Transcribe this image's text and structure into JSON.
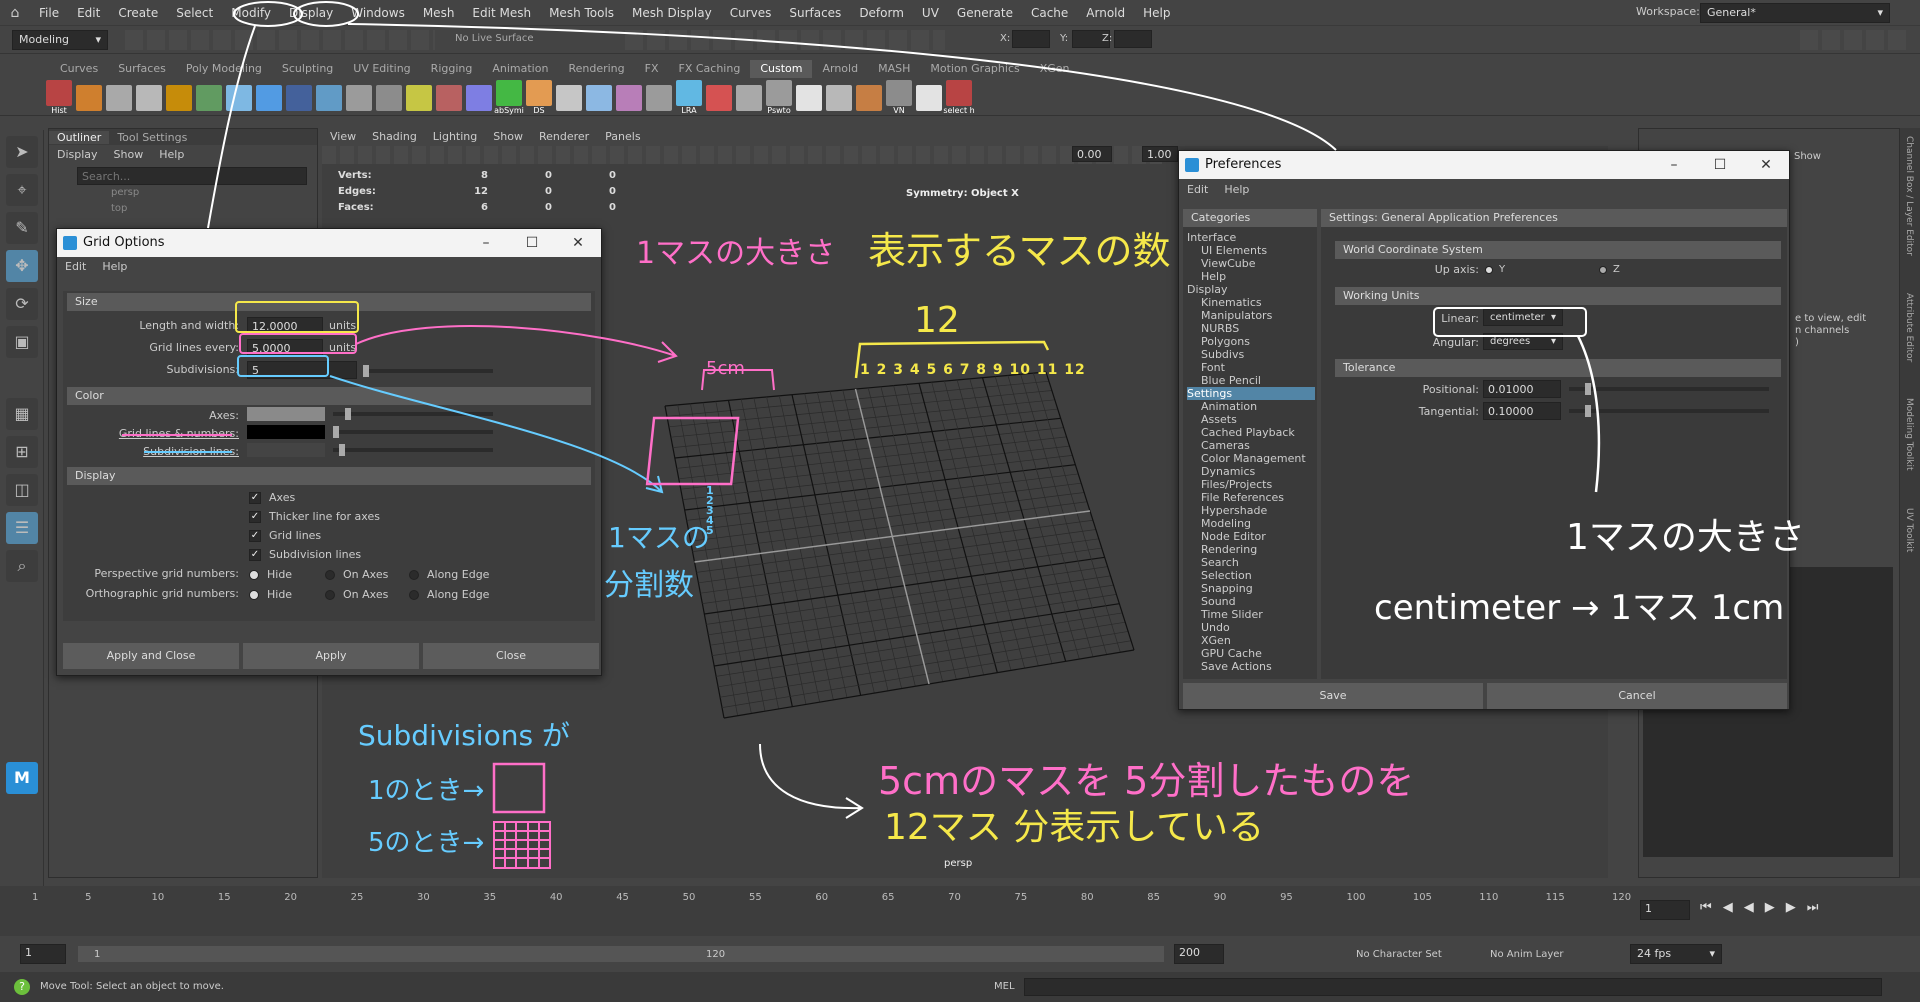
{
  "menubar": {
    "items": [
      "File",
      "Edit",
      "Create",
      "Select",
      "Modify",
      "Display",
      "Windows",
      "Mesh",
      "Edit Mesh",
      "Mesh Tools",
      "Mesh Display",
      "Curves",
      "Surfaces",
      "Deform",
      "UV",
      "Generate",
      "Cache",
      "Arnold",
      "Help"
    ],
    "workspace_label": "Workspace:",
    "workspace_value": "General*"
  },
  "toolbar": {
    "mode": "Modeling",
    "live_surface": "No Live Surface",
    "x": "X:",
    "y": "Y:",
    "z": "Z:"
  },
  "shelf": {
    "tabs": [
      "Curves",
      "Surfaces",
      "Poly Modeling",
      "Sculpting",
      "UV Editing",
      "Rigging",
      "Animation",
      "Rendering",
      "FX",
      "FX Caching",
      "Custom",
      "Arnold",
      "MASH",
      "Motion Graphics",
      "XGen"
    ],
    "active": "Custom",
    "icon_labels": [
      "Hist",
      "abSymi",
      "DS",
      "LRA",
      "Pswto",
      "VN",
      "select h"
    ]
  },
  "outliner": {
    "tabs": [
      "Outliner",
      "Tool Settings"
    ],
    "menu": [
      "Display",
      "Show",
      "Help"
    ],
    "search_placeholder": "Search...",
    "items": [
      "persp",
      "top"
    ]
  },
  "viewport": {
    "menu": [
      "View",
      "Shading",
      "Lighting",
      "Show",
      "Renderer",
      "Panels"
    ],
    "hud": {
      "rows": [
        {
          "k": "Verts:",
          "v": [
            "8",
            "0",
            "0"
          ]
        },
        {
          "k": "Edges:",
          "v": [
            "12",
            "0",
            "0"
          ]
        },
        {
          "k": "Faces:",
          "v": [
            "6",
            "0",
            "0"
          ]
        }
      ]
    },
    "symmetry": "Symmetry: Object X",
    "camera": "persp",
    "field_a": "0.00",
    "field_b": "1.00"
  },
  "grid_options": {
    "title": "Grid Options",
    "menu": [
      "Edit",
      "Help"
    ],
    "size_section": "Size",
    "length_label": "Length and width:",
    "length_value": "12.0000",
    "units": "units",
    "gridlines_label": "Grid lines every:",
    "gridlines_value": "5.0000",
    "subdiv_label": "Subdivisions:",
    "subdiv_value": "5",
    "color_section": "Color",
    "axes_label": "Axes:",
    "gridcolor_label": "Grid lines & numbers:",
    "subcolor_label": "Subdivision lines:",
    "display_section": "Display",
    "chk_axes": "Axes",
    "chk_thicker": "Thicker line for axes",
    "chk_grid": "Grid lines",
    "chk_subdiv": "Subdivision lines",
    "persp_label": "Perspective grid numbers:",
    "ortho_label": "Orthographic grid numbers:",
    "opt_hide": "Hide",
    "opt_on_axes": "On Axes",
    "opt_along_edge": "Along Edge",
    "btn_apply_close": "Apply and Close",
    "btn_apply": "Apply",
    "btn_close": "Close"
  },
  "preferences": {
    "title": "Preferences",
    "menu": [
      "Edit",
      "Help"
    ],
    "categories_header": "Categories",
    "settings_header": "Settings: General Application Preferences",
    "categories": [
      {
        "t": "Interface",
        "s": 0
      },
      {
        "t": "UI Elements",
        "s": 1
      },
      {
        "t": "ViewCube",
        "s": 1
      },
      {
        "t": "Help",
        "s": 1
      },
      {
        "t": "Display",
        "s": 0
      },
      {
        "t": "Kinematics",
        "s": 1
      },
      {
        "t": "Manipulators",
        "s": 1
      },
      {
        "t": "NURBS",
        "s": 1
      },
      {
        "t": "Polygons",
        "s": 1
      },
      {
        "t": "Subdivs",
        "s": 1
      },
      {
        "t": "Font",
        "s": 1
      },
      {
        "t": "Blue Pencil",
        "s": 1
      },
      {
        "t": "Settings",
        "s": 0,
        "on": 1
      },
      {
        "t": "Animation",
        "s": 1
      },
      {
        "t": "Assets",
        "s": 1
      },
      {
        "t": "Cached Playback",
        "s": 1
      },
      {
        "t": "Cameras",
        "s": 1
      },
      {
        "t": "Color Management",
        "s": 1
      },
      {
        "t": "Dynamics",
        "s": 1
      },
      {
        "t": "Files/Projects",
        "s": 1
      },
      {
        "t": "File References",
        "s": 1
      },
      {
        "t": "Hypershade",
        "s": 1
      },
      {
        "t": "Modeling",
        "s": 1
      },
      {
        "t": "Node Editor",
        "s": 1
      },
      {
        "t": "Rendering",
        "s": 1
      },
      {
        "t": "Search",
        "s": 1
      },
      {
        "t": "Selection",
        "s": 1
      },
      {
        "t": "Snapping",
        "s": 1
      },
      {
        "t": "Sound",
        "s": 1
      },
      {
        "t": "Time Slider",
        "s": 1
      },
      {
        "t": "Undo",
        "s": 1
      },
      {
        "t": "XGen",
        "s": 1
      },
      {
        "t": "GPU Cache",
        "s": 1
      },
      {
        "t": "Save Actions",
        "s": 1
      }
    ],
    "wcs_section": "World Coordinate System",
    "upaxis_label": "Up axis:",
    "upaxis_y": "Y",
    "upaxis_z": "Z",
    "units_section": "Working Units",
    "linear_label": "Linear:",
    "linear_value": "centimeter",
    "angular_label": "Angular:",
    "angular_value": "degrees",
    "tol_section": "Tolerance",
    "positional_label": "Positional:",
    "positional_value": "0.01000",
    "tangential_label": "Tangential:",
    "tangential_value": "0.10000",
    "btn_save": "Save",
    "btn_cancel": "Cancel"
  },
  "channel_box": {
    "show": "Show",
    "hint1": "e to view, edit",
    "hint2": "n channels",
    "hint3": ")",
    "side_tabs": [
      "Channel Box / Layer Editor",
      "Attribute Editor",
      "Modeling Toolkit",
      "UV Toolkit"
    ]
  },
  "timeline": {
    "ticks": [
      "1",
      "5",
      "10",
      "15",
      "20",
      "25",
      "30",
      "35",
      "40",
      "45",
      "50",
      "55",
      "60",
      "65",
      "70",
      "75",
      "80",
      "85",
      "90",
      "95",
      "100",
      "105",
      "110",
      "115",
      "120"
    ],
    "current": "1"
  },
  "range": {
    "start": "1",
    "inner_start": "1",
    "inner_end": "120",
    "end": "200",
    "char_set": "No Character Set",
    "anim_layer": "No Anim Layer",
    "fps": "24 fps"
  },
  "statusbar": {
    "help": "Move Tool: Select an object to move.",
    "mel": "MEL"
  },
  "annotations": {
    "one_cell_size": "1マスの大きさ",
    "num_cells": "表示するマスの数",
    "twelve": "12",
    "five_cm": "5cm",
    "numbers_row": "1 2 3 4 5 6 7 8 9 10 11 12",
    "col_numbers": "1 2 3 4 5",
    "subdiv_note_1": "1マスの",
    "subdiv_note_2": "分割数",
    "subdiv_title": "Subdivisions が",
    "sub_one": "1のとき→",
    "sub_five": "5のとき→",
    "summary_1": "5cmのマスを 5分割したものを",
    "summary_2": "12マス 分表示している",
    "pref_note_1": "1マスの大きさ",
    "pref_note_2": "centimeter → 1マス 1cm"
  },
  "colors": {
    "pink": "#ff6fc8",
    "yellow": "#f5e84a",
    "blue": "#66ccff",
    "white": "#ffffff",
    "accent": "#5285a6"
  }
}
